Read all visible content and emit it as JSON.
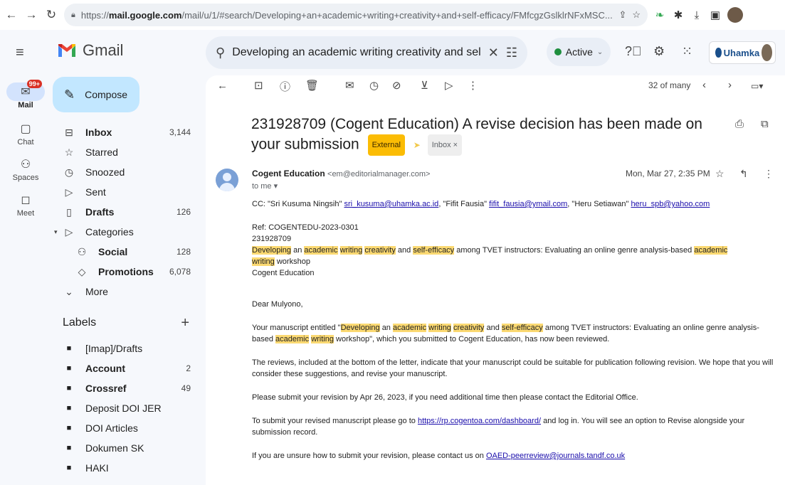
{
  "browser": {
    "url_prefix": "https://",
    "url_domain": "mail.google.com",
    "url_rest": "/mail/u/1/#search/Developing+an+academic+writing+creativity+and+self-efficacy/FMfcgzGslklrNFxMSC..."
  },
  "header": {
    "app_name": "Gmail",
    "search_value": "Developing an academic writing creativity and self-",
    "status": "Active",
    "org_name": "Uhamka"
  },
  "rail": {
    "mail": "Mail",
    "mail_badge": "99+",
    "chat": "Chat",
    "spaces": "Spaces",
    "meet": "Meet"
  },
  "sidebar": {
    "compose": "Compose",
    "items": [
      {
        "label": "Inbox",
        "count": "3,144"
      },
      {
        "label": "Starred",
        "count": ""
      },
      {
        "label": "Snoozed",
        "count": ""
      },
      {
        "label": "Sent",
        "count": ""
      },
      {
        "label": "Drafts",
        "count": "126"
      },
      {
        "label": "Categories",
        "count": ""
      },
      {
        "label": "Social",
        "count": "128"
      },
      {
        "label": "Promotions",
        "count": "6,078"
      },
      {
        "label": "More",
        "count": ""
      }
    ],
    "labels_title": "Labels",
    "labels": [
      {
        "label": "[Imap]/Drafts",
        "count": ""
      },
      {
        "label": "Account",
        "count": "2"
      },
      {
        "label": "Crossref",
        "count": "49"
      },
      {
        "label": "Deposit DOI JER",
        "count": ""
      },
      {
        "label": "DOI Articles",
        "count": ""
      },
      {
        "label": "Dokumen SK",
        "count": ""
      },
      {
        "label": "HAKI",
        "count": ""
      }
    ]
  },
  "toolbar": {
    "pager": "32 of many"
  },
  "email": {
    "subject": "231928709 (Cogent Education) A revise decision has been made on your submission",
    "tag_external": "External",
    "tag_inbox": "Inbox",
    "sender_name": "Cogent Education",
    "sender_email": "<em@editorialmanager.com>",
    "to": "to me",
    "date": "Mon, Mar 27, 2:35 PM",
    "cc_prefix": "CC: \"Sri Kusuma Ningsih\" ",
    "cc_email1": "sri_kusuma@uhamka.ac.id",
    "cc_mid1": ", \"Fifit Fausia\" ",
    "cc_email2": "fifit_fausia@ymail.com",
    "cc_mid2": ", \"Heru Setiawan\" ",
    "cc_email3": "heru_spb@yahoo.com",
    "ref": "Ref: COGENTEDU-2023-0301",
    "ref_num": "231928709",
    "title_rest": "among TVET instructors: Evaluating an online genre analysis-based",
    "title_end": "workshop",
    "journal": "Cogent Education",
    "dear": "Dear  Mulyono,",
    "p1_a": "Your manuscript entitled \"",
    "p1_b": "among TVET instructors: Evaluating an online genre analysis-based",
    "p1_c": "workshop\", which you submitted to Cogent Education, has now been reviewed.",
    "p2": "The reviews, included at the bottom of the letter, indicate that your manuscript could be suitable for publication following revision. We hope that you will consider these suggestions, and revise your manuscript.",
    "p3": "Please submit your revision by Apr 26, 2023, if you need additional time then please contact the Editorial Office.",
    "p4_a": "To submit your revised manuscript please go to ",
    "p4_link": "https://rp.cogentoa.com/dashboard/",
    "p4_b": " and log in. You will see an option to Revise alongside your submission record.",
    "p5_a": "If you are unsure how to submit your revision, please contact us on ",
    "p5_link": "OAED-peerreview@journals.tandf.co.uk",
    "hl": {
      "developing": "Developing",
      "an": "an",
      "academic": "academic",
      "writing": "writing",
      "creativity": "creativity",
      "and": "and",
      "self_efficacy": "self-efficacy"
    }
  }
}
